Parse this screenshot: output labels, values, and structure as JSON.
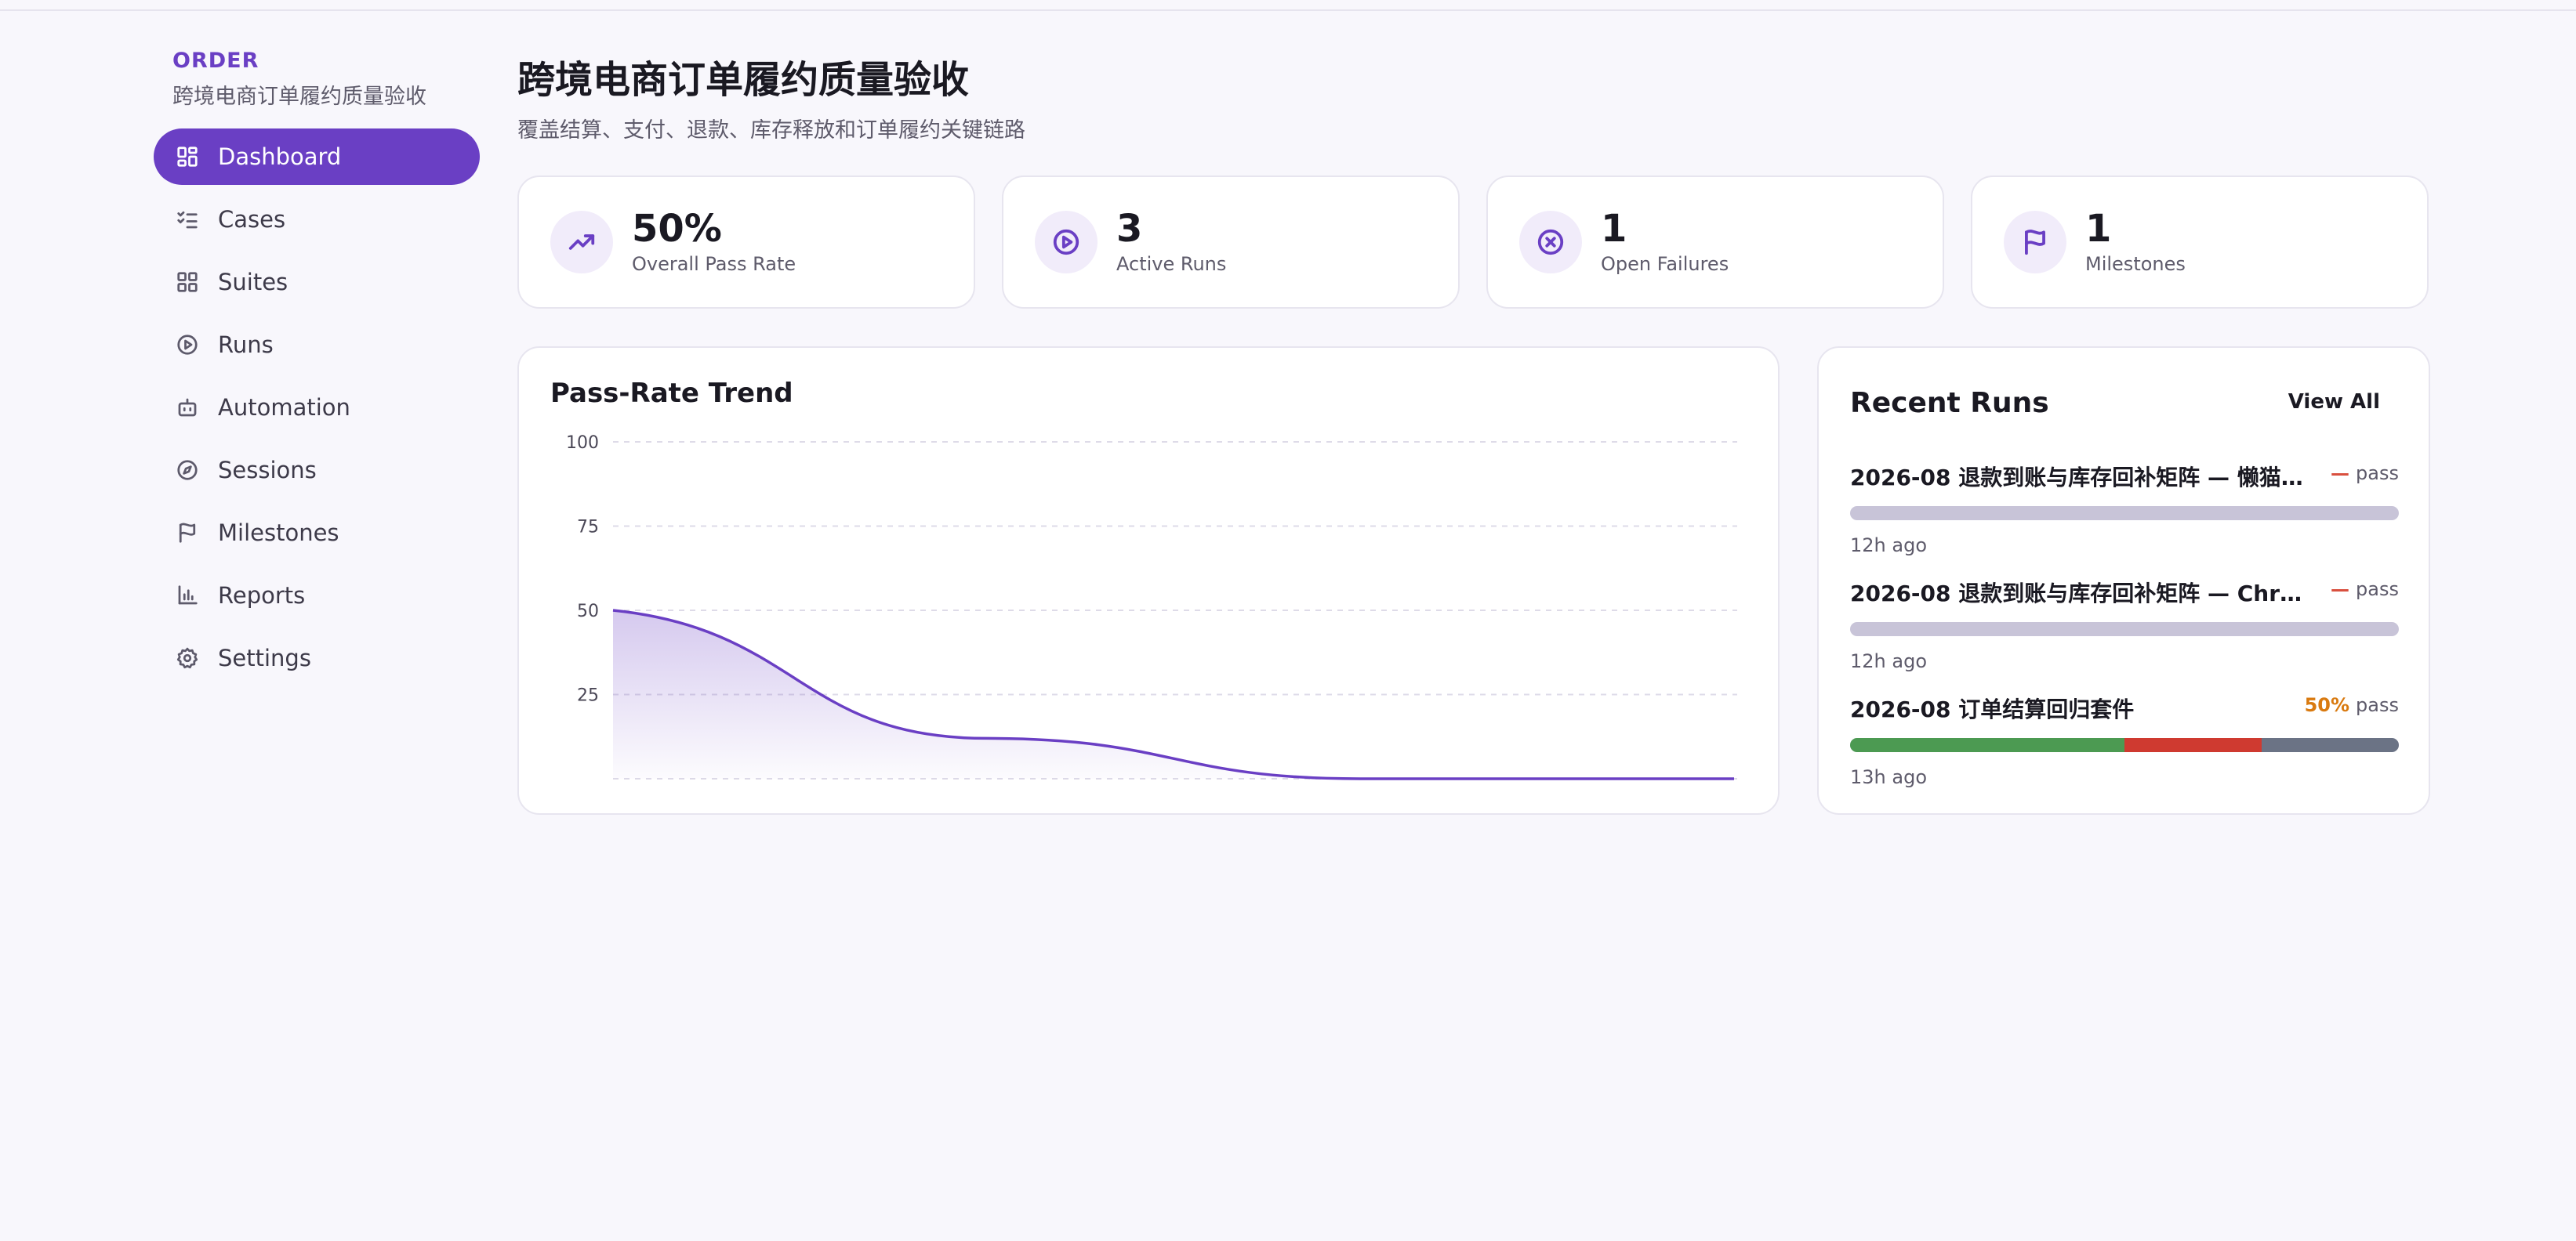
{
  "sidebar": {
    "brand": "ORDER",
    "subtitle": "跨境电商订单履约质量验收",
    "items": [
      {
        "label": "Dashboard",
        "icon": "dashboard-icon",
        "active": true
      },
      {
        "label": "Cases",
        "icon": "checklist-icon"
      },
      {
        "label": "Suites",
        "icon": "grid-icon"
      },
      {
        "label": "Runs",
        "icon": "play-circle-icon"
      },
      {
        "label": "Automation",
        "icon": "robot-icon"
      },
      {
        "label": "Sessions",
        "icon": "compass-icon"
      },
      {
        "label": "Milestones",
        "icon": "flag-icon"
      },
      {
        "label": "Reports",
        "icon": "bar-chart-icon"
      },
      {
        "label": "Settings",
        "icon": "gear-icon"
      }
    ]
  },
  "header": {
    "title": "跨境电商订单履约质量验收",
    "subtitle": "覆盖结算、支付、退款、库存释放和订单履约关键链路"
  },
  "stats": [
    {
      "value": "50%",
      "label": "Overall Pass Rate",
      "icon": "trending-up-icon"
    },
    {
      "value": "3",
      "label": "Active Runs",
      "icon": "play-circle-icon"
    },
    {
      "value": "1",
      "label": "Open Failures",
      "icon": "x-circle-icon"
    },
    {
      "value": "1",
      "label": "Milestones",
      "icon": "flag-icon"
    }
  ],
  "trend": {
    "title": "Pass-Rate Trend"
  },
  "chart_data": {
    "type": "area",
    "title": "Pass-Rate Trend",
    "xlabel": "",
    "ylabel": "",
    "yticks": [
      "100",
      "75",
      "50",
      "25"
    ],
    "ylim": [
      0,
      100
    ],
    "x": [
      0,
      1,
      2,
      3
    ],
    "values": [
      50,
      12,
      0,
      0
    ],
    "color": "#6a3fc4",
    "grid": true
  },
  "recent": {
    "title": "Recent Runs",
    "view_all": "View All",
    "runs": [
      {
        "name": "2026-08 退款到账与库存回补矩阵 — 懒猫内...",
        "pct": "—",
        "pass": "pass",
        "time": "12h ago",
        "segments": []
      },
      {
        "name": "2026-08 退款到账与库存回补矩阵 — Chro...",
        "pct": "—",
        "pass": "pass",
        "time": "12h ago",
        "segments": []
      },
      {
        "name": "2026-08 订单结算回归套件",
        "pct": "50%",
        "pass": "pass",
        "time": "13h ago",
        "segments": [
          {
            "status": "passed",
            "fraction": 0.5,
            "color": "#4c9a52"
          },
          {
            "status": "failed",
            "fraction": 0.25,
            "color": "#cf3a30"
          },
          {
            "status": "untested",
            "fraction": 0.25,
            "color": "#6b7385"
          }
        ]
      }
    ]
  },
  "colors": {
    "accent": "#6a3fc4",
    "pct_highlight": "#d97a10",
    "dash_red": "#d9503f"
  }
}
